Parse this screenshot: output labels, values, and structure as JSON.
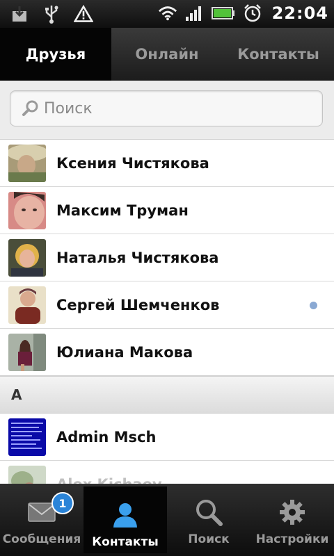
{
  "status_bar": {
    "time": "22:04",
    "icons": [
      "download-icon",
      "usb-icon",
      "warning-icon",
      "wifi-icon",
      "signal-icon",
      "battery-icon",
      "alarm-icon"
    ]
  },
  "tabs": [
    {
      "label": "Друзья",
      "active": true
    },
    {
      "label": "Онлайн",
      "active": false
    },
    {
      "label": "Контакты",
      "active": false
    }
  ],
  "search": {
    "placeholder": "Поиск",
    "value": ""
  },
  "contacts": [
    {
      "name": "Ксения Чистякова",
      "online": false
    },
    {
      "name": "Максим Труман",
      "online": false
    },
    {
      "name": "Наталья Чистякова",
      "online": false
    },
    {
      "name": "Сергей Шемченков",
      "online": true
    },
    {
      "name": "Юлиана Макова",
      "online": false
    }
  ],
  "section": {
    "letter": "A"
  },
  "section_contacts": [
    {
      "name": "Admin Msch"
    },
    {
      "name": "Alex Kichaev"
    }
  ],
  "bottom_nav": [
    {
      "label": "Сообщения",
      "icon": "envelope-icon",
      "badge": "1",
      "active": false
    },
    {
      "label": "Контакты",
      "icon": "person-icon",
      "active": true
    },
    {
      "label": "Поиск",
      "icon": "magnifier-icon",
      "active": false
    },
    {
      "label": "Настройки",
      "icon": "gear-icon",
      "active": false
    }
  ],
  "colors": {
    "accent": "#2a84d8",
    "online_dot": "#8aa9d3"
  }
}
